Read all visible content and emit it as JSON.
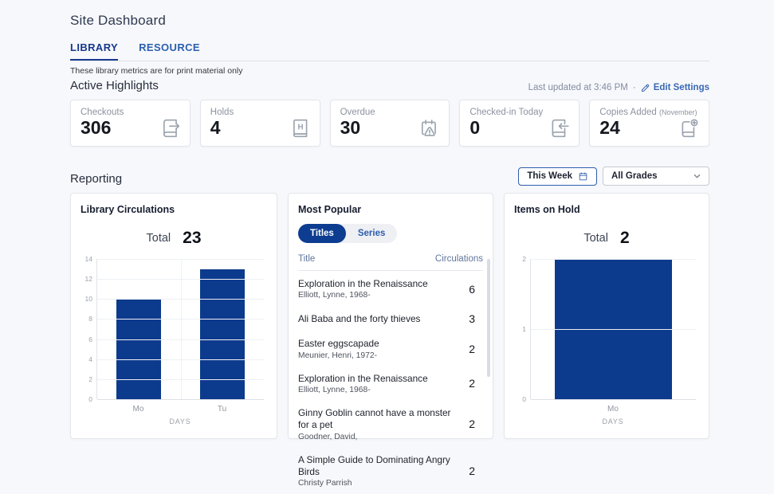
{
  "page": {
    "title": "Site Dashboard"
  },
  "tabs": [
    {
      "label": "LIBRARY",
      "active": true
    },
    {
      "label": "RESOURCE",
      "active": false
    }
  ],
  "note": "These library metrics are for print material only",
  "highlights": {
    "heading": "Active Highlights",
    "last_updated": "Last updated at 3:46 PM",
    "separator": "·",
    "edit_settings": "Edit Settings",
    "cards": [
      {
        "label": "Checkouts",
        "value": "306",
        "icon": "book-checkout-icon"
      },
      {
        "label": "Holds",
        "value": "4",
        "icon": "book-hold-icon"
      },
      {
        "label": "Overdue",
        "value": "30",
        "icon": "calendar-alert-icon"
      },
      {
        "label": "Checked-in Today",
        "value": "0",
        "icon": "book-checkin-icon"
      },
      {
        "label": "Copies Added",
        "sublabel": "(November)",
        "value": "24",
        "icon": "book-add-icon"
      }
    ]
  },
  "reporting": {
    "heading": "Reporting",
    "week_filter": "This Week",
    "grade_filter": "All Grades"
  },
  "most_popular": {
    "title": "Most Popular",
    "toggle": [
      {
        "label": "Titles",
        "active": true
      },
      {
        "label": "Series",
        "active": false
      }
    ],
    "columns": {
      "title": "Title",
      "count": "Circulations"
    },
    "rows": [
      {
        "title": "Exploration in the Renaissance",
        "author": "Elliott, Lynne, 1968-",
        "count": "6"
      },
      {
        "title": "Ali Baba and the forty thieves",
        "author": "",
        "count": "3"
      },
      {
        "title": "Easter eggscapade",
        "author": "Meunier, Henri, 1972-",
        "count": "2"
      },
      {
        "title": "Exploration in the Renaissance",
        "author": "Elliott, Lynne, 1968-",
        "count": "2"
      },
      {
        "title": "Ginny Goblin cannot have a monster for a pet",
        "author": "Goodner, David,",
        "count": "2"
      },
      {
        "title": "A Simple Guide to Dominating Angry Birds",
        "author": "Christy Parrish",
        "count": "2"
      }
    ]
  },
  "chart_data": [
    {
      "type": "bar",
      "title": "Library Circulations",
      "total_label": "Total",
      "total": "23",
      "categories": [
        "Mo",
        "Tu"
      ],
      "values": [
        10,
        13
      ],
      "xlabel": "DAYS",
      "ylabel": "",
      "ylim": [
        0,
        14
      ],
      "ytick_step": 2,
      "grid": true,
      "legend": false,
      "bar_color": "#0c3a8d"
    },
    {
      "type": "bar",
      "title": "Items on Hold",
      "total_label": "Total",
      "total": "2",
      "categories": [
        "Mo"
      ],
      "values": [
        2
      ],
      "xlabel": "DAYS",
      "ylabel": "",
      "ylim": [
        0,
        2
      ],
      "ytick_step": 1,
      "grid": true,
      "legend": false,
      "bar_color": "#0c3a8d"
    }
  ],
  "colors": {
    "accent": "#0c3a8d",
    "active_tab": "#17398c",
    "link": "#3a68b3",
    "pill_active": "#0d3d91"
  }
}
